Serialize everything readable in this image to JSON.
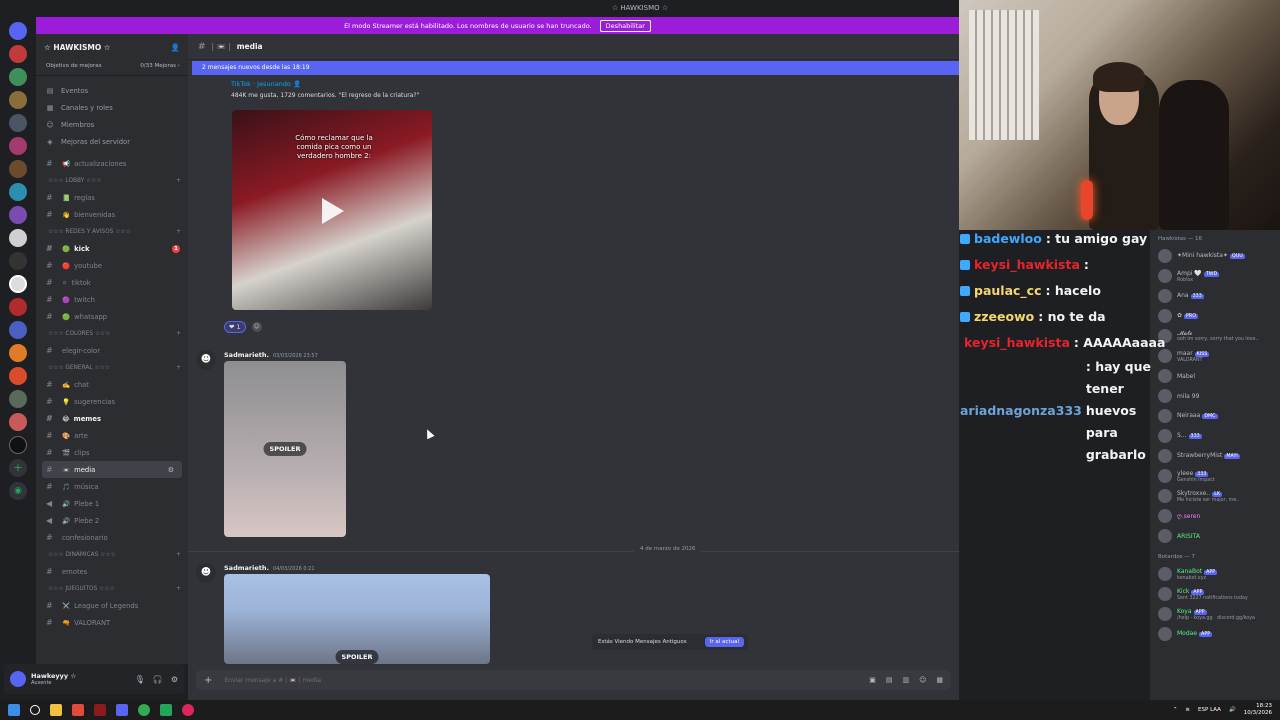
{
  "window": {
    "title": "☆ HAWKISMO ☆"
  },
  "banner": {
    "text": "El modo Streamer está habilitado. Los nombres de usuario se han truncado.",
    "button": "Deshabilitar"
  },
  "server": {
    "name": "☆ HAWKISMO ☆",
    "goal_label": "Objetivo de mejoras",
    "goal_value": "0/33 Mejoras ›",
    "links": [
      {
        "icon": "calendar-icon",
        "label": "Eventos"
      },
      {
        "icon": "channels-roles-icon",
        "label": "Canales y roles"
      },
      {
        "icon": "members-icon",
        "label": "Miembros"
      },
      {
        "icon": "boost-icon",
        "label": "Mejoras del servidor"
      }
    ]
  },
  "channels": {
    "top": {
      "emoji": "📢",
      "label": "actualizaciones"
    },
    "categories": [
      {
        "name": "☆☆☆ LOBBY ☆☆☆",
        "items": [
          {
            "emoji": "📗",
            "label": "reglas",
            "bold": false
          },
          {
            "emoji": "👋",
            "label": "bienvenidas",
            "bold": false
          }
        ]
      },
      {
        "name": "☆☆☆ REDES Y AVISOS ☆☆☆",
        "items": [
          {
            "emoji": "🟢",
            "label": "kick",
            "bold": true,
            "badge": "1"
          },
          {
            "emoji": "🔴",
            "label": "youtube",
            "bold": false
          },
          {
            "emoji": "⚪",
            "label": "tiktok",
            "bold": false
          },
          {
            "emoji": "🟣",
            "label": "twitch",
            "bold": false
          },
          {
            "emoji": "🟢",
            "label": "whatsapp",
            "bold": false
          }
        ]
      },
      {
        "name": "☆☆☆ COLORES ☆☆☆",
        "items": [
          {
            "emoji": "",
            "label": "elegir-color",
            "bold": false
          }
        ]
      },
      {
        "name": "☆☆☆ GENERAL ☆☆☆",
        "items": [
          {
            "emoji": "✍️",
            "label": "chat",
            "bold": false
          },
          {
            "emoji": "💡",
            "label": "sugerencias",
            "bold": false
          },
          {
            "emoji": "😂",
            "label": "memes",
            "bold": true
          },
          {
            "emoji": "🎨",
            "label": "arte",
            "bold": false
          },
          {
            "emoji": "🎬",
            "label": "clips",
            "bold": false
          },
          {
            "emoji": "📼",
            "label": "media",
            "bold": false,
            "active": true
          },
          {
            "emoji": "🎵",
            "label": "música",
            "bold": false
          },
          {
            "emoji": "🔊",
            "label": "Plebe 1",
            "bold": false
          },
          {
            "emoji": "🔊",
            "label": "Plebe 2",
            "bold": false
          },
          {
            "emoji": "",
            "label": "confesionario",
            "bold": false
          }
        ]
      },
      {
        "name": "☆☆☆ DINÁMICAS ☆☆☆",
        "items": [
          {
            "emoji": "",
            "label": "emotes",
            "bold": false
          }
        ]
      },
      {
        "name": "☆☆☆ JUEGUITOS ☆☆☆",
        "items": [
          {
            "emoji": "⚔️",
            "label": "League of Legends",
            "bold": false
          },
          {
            "emoji": "🔫",
            "label": "VALORANT",
            "bold": false
          }
        ]
      }
    ]
  },
  "user": {
    "name": "Hawkeyyy ☆",
    "status": "Ausente"
  },
  "chat": {
    "channel": "media",
    "new_messages": "2 mensajes nuevos desde las 18:19",
    "embed_source": "TikTok · Jesunando 👤",
    "embed_desc": "484K me gusta, 1729 comentarios. \"El regreso de la criatura?\"",
    "video_caption": "Cómo reclamar que la comida pica como un verdadero hombre 2:",
    "reaction_count": "1",
    "messages": [
      {
        "author": "Sadmarieth.",
        "time": "03/03/2026 23:57",
        "spoiler": "SPOILER"
      },
      {
        "author": "Sadmarieth.",
        "time": "04/03/2026 0:21",
        "spoiler": "SPOILER"
      }
    ],
    "date_divider": "4 de marzo de 2026",
    "jump_text": "Estás Viendo Mensajes Antiguos",
    "jump_button": "Ir al actual",
    "composer_placeholder": "Enviar mensaje a # | 📼 | media"
  },
  "stream_chat": [
    {
      "user": "badewloo",
      "color": "#3fa9ff",
      "msg": ": tu amigo gay"
    },
    {
      "user": "keysi_hawkista",
      "color": "#e8232b",
      "msg": ":"
    },
    {
      "user": "paulac_cc",
      "color": "#f5d76e",
      "msg": ": hacelo"
    },
    {
      "user": "zzeeowo",
      "color": "#f5d76e",
      "msg": ": no te da"
    },
    {
      "user": "keysi_hawkista",
      "color": "#e8232b",
      "msg": ": AAAAAaaaa"
    },
    {
      "user": "ariadnagonza333",
      "color": "#6fa3d8",
      "msg": ": hay que tener huevos para grabarlo"
    }
  ],
  "members": {
    "group1": "Hawkistas — 16",
    "list1": [
      {
        "name": "✦Mini hawkista✦",
        "tag": "QUU",
        "sub": "",
        "color": "#b5bac1"
      },
      {
        "name": "Ampi 🤍",
        "tag": "TWD",
        "sub": "Roblox",
        "color": "#b5bac1"
      },
      {
        "name": "Ana",
        "tag": "333",
        "sub": "",
        "color": "#b5bac1"
      },
      {
        "name": "✿",
        "tag": "PRO",
        "sub": "",
        "color": "#b5bac1"
      },
      {
        "name": "𝓜𝓪𝓽𝓮",
        "tag": "",
        "sub": "ooh im sorry, sorry that you love..",
        "color": "#b5bac1"
      },
      {
        "name": "maar",
        "tag": "KISS",
        "sub": "VALORANT",
        "color": "#b5bac1"
      },
      {
        "name": "Mabel",
        "tag": "",
        "sub": "",
        "color": "#b5bac1"
      },
      {
        "name": "mila 99",
        "tag": "",
        "sub": "",
        "color": "#b5bac1"
      },
      {
        "name": "Neiraaa",
        "tag": "DMC",
        "sub": "",
        "color": "#b5bac1"
      },
      {
        "name": "S...",
        "tag": "333",
        "sub": "",
        "color": "#b5bac1"
      },
      {
        "name": "StrawberryMist",
        "tag": "MAYI",
        "sub": "",
        "color": "#b5bac1"
      },
      {
        "name": "yleee",
        "tag": "333",
        "sub": "Genshin Impact",
        "color": "#b5bac1"
      },
      {
        "name": "Skytroxxe..",
        "tag": "LK",
        "sub": "Me hiciste ser major, me..",
        "color": "#b5bac1"
      },
      {
        "name": "ღ.seren",
        "tag": "",
        "sub": "",
        "color": "#f47fff"
      },
      {
        "name": "ARISITA",
        "tag": "",
        "sub": "",
        "color": "#57f287"
      }
    ],
    "group2": "Botardos — 7",
    "list2": [
      {
        "name": "KanaBot",
        "tag": "APP",
        "sub": "kenabot.xyz",
        "color": "#57f287"
      },
      {
        "name": "Kick",
        "tag": "APP",
        "sub": "Sent 3227 notifications today",
        "color": "#57f287"
      },
      {
        "name": "Koya",
        "tag": "APP",
        "sub": "/help · koya.gg · discord.gg/koya",
        "color": "#57f287"
      },
      {
        "name": "Modae",
        "tag": "APP",
        "sub": "",
        "color": "#57f287"
      }
    ]
  },
  "taskbar": {
    "lang": "ESP LAA",
    "time": "18:23",
    "date": "10/3/2026"
  }
}
